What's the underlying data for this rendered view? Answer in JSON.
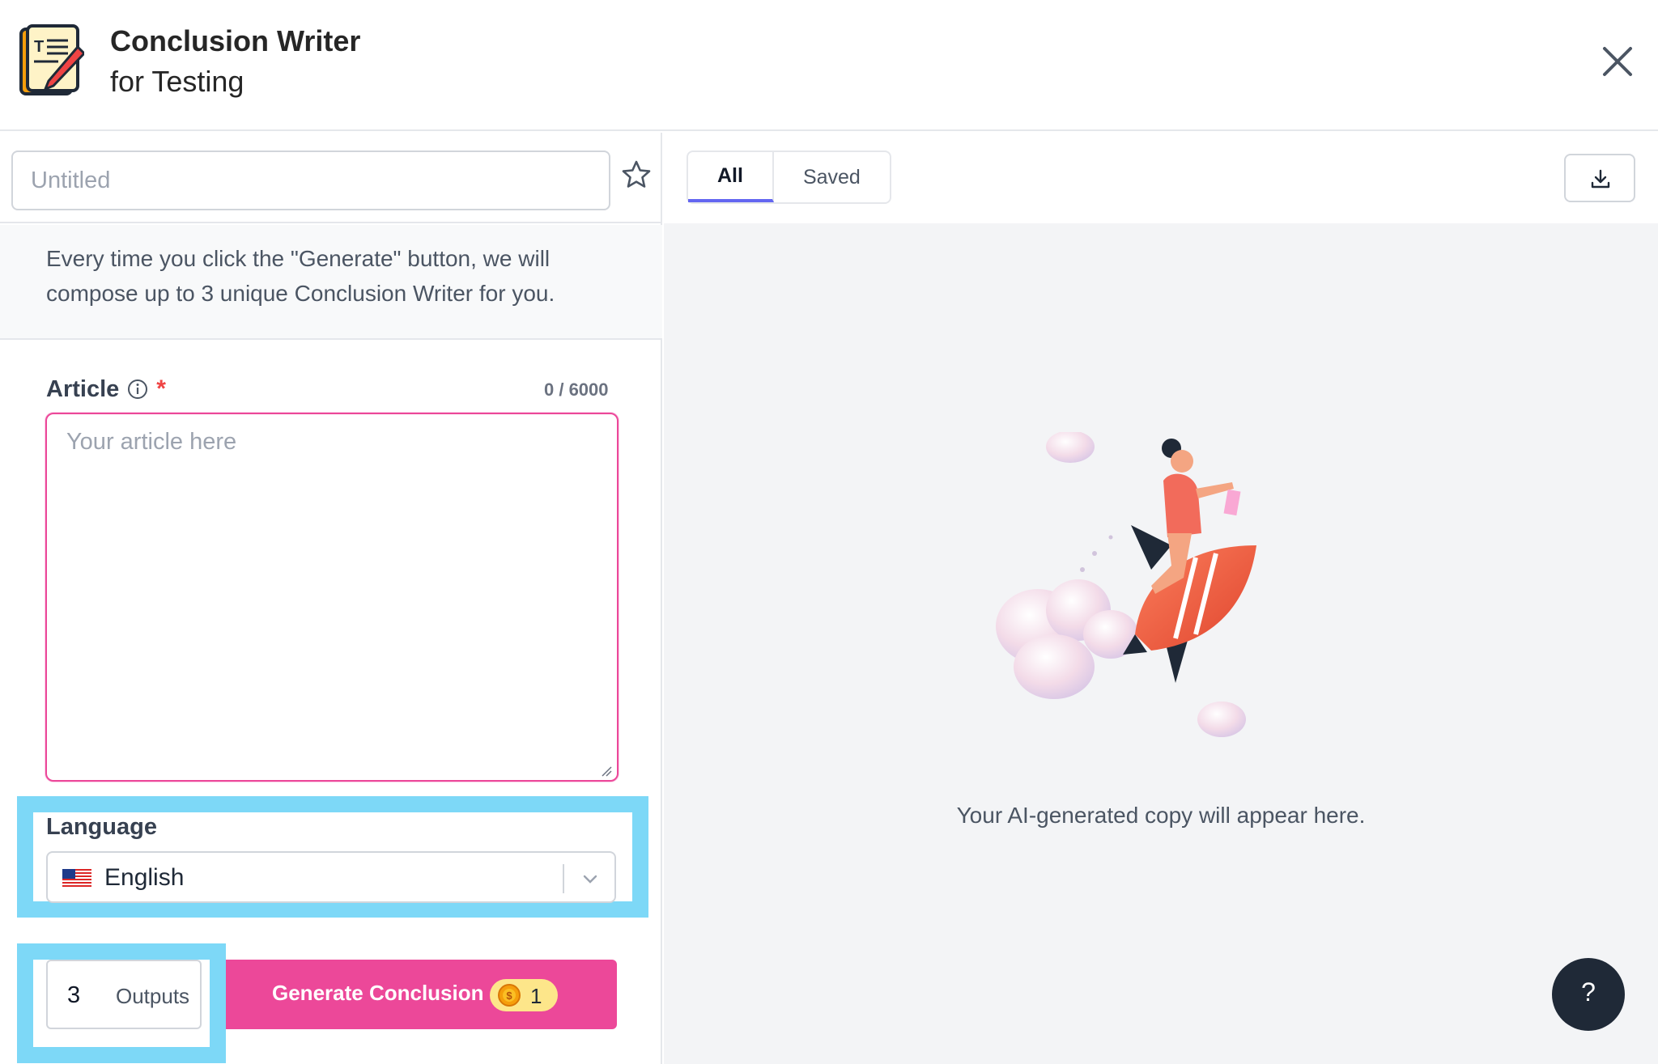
{
  "header": {
    "title": "Conclusion Writer",
    "subtitle": "for Testing"
  },
  "document": {
    "title_placeholder": "Untitled"
  },
  "info": {
    "text": "Every time you click the \"Generate\" button, we will compose up to 3 unique Conclusion Writer for you."
  },
  "article": {
    "label": "Article",
    "required_mark": "*",
    "char_count": "0 / 6000",
    "placeholder": "Your article here",
    "value": ""
  },
  "language": {
    "label": "Language",
    "selected": "English",
    "flag_icon": "us-flag-icon"
  },
  "outputs": {
    "count": "3",
    "label": "Outputs"
  },
  "generate": {
    "label": "Generate Conclusion",
    "credit_cost": "1"
  },
  "results": {
    "tabs": [
      {
        "label": "All",
        "active": true
      },
      {
        "label": "Saved",
        "active": false
      }
    ],
    "empty_message": "Your AI-generated copy will appear here."
  },
  "help": {
    "label": "?"
  },
  "colors": {
    "accent": "#ec4899",
    "highlight_outline": "#7dd8f7",
    "tab_underline": "#6366f1",
    "help_bg": "#1f2937"
  }
}
